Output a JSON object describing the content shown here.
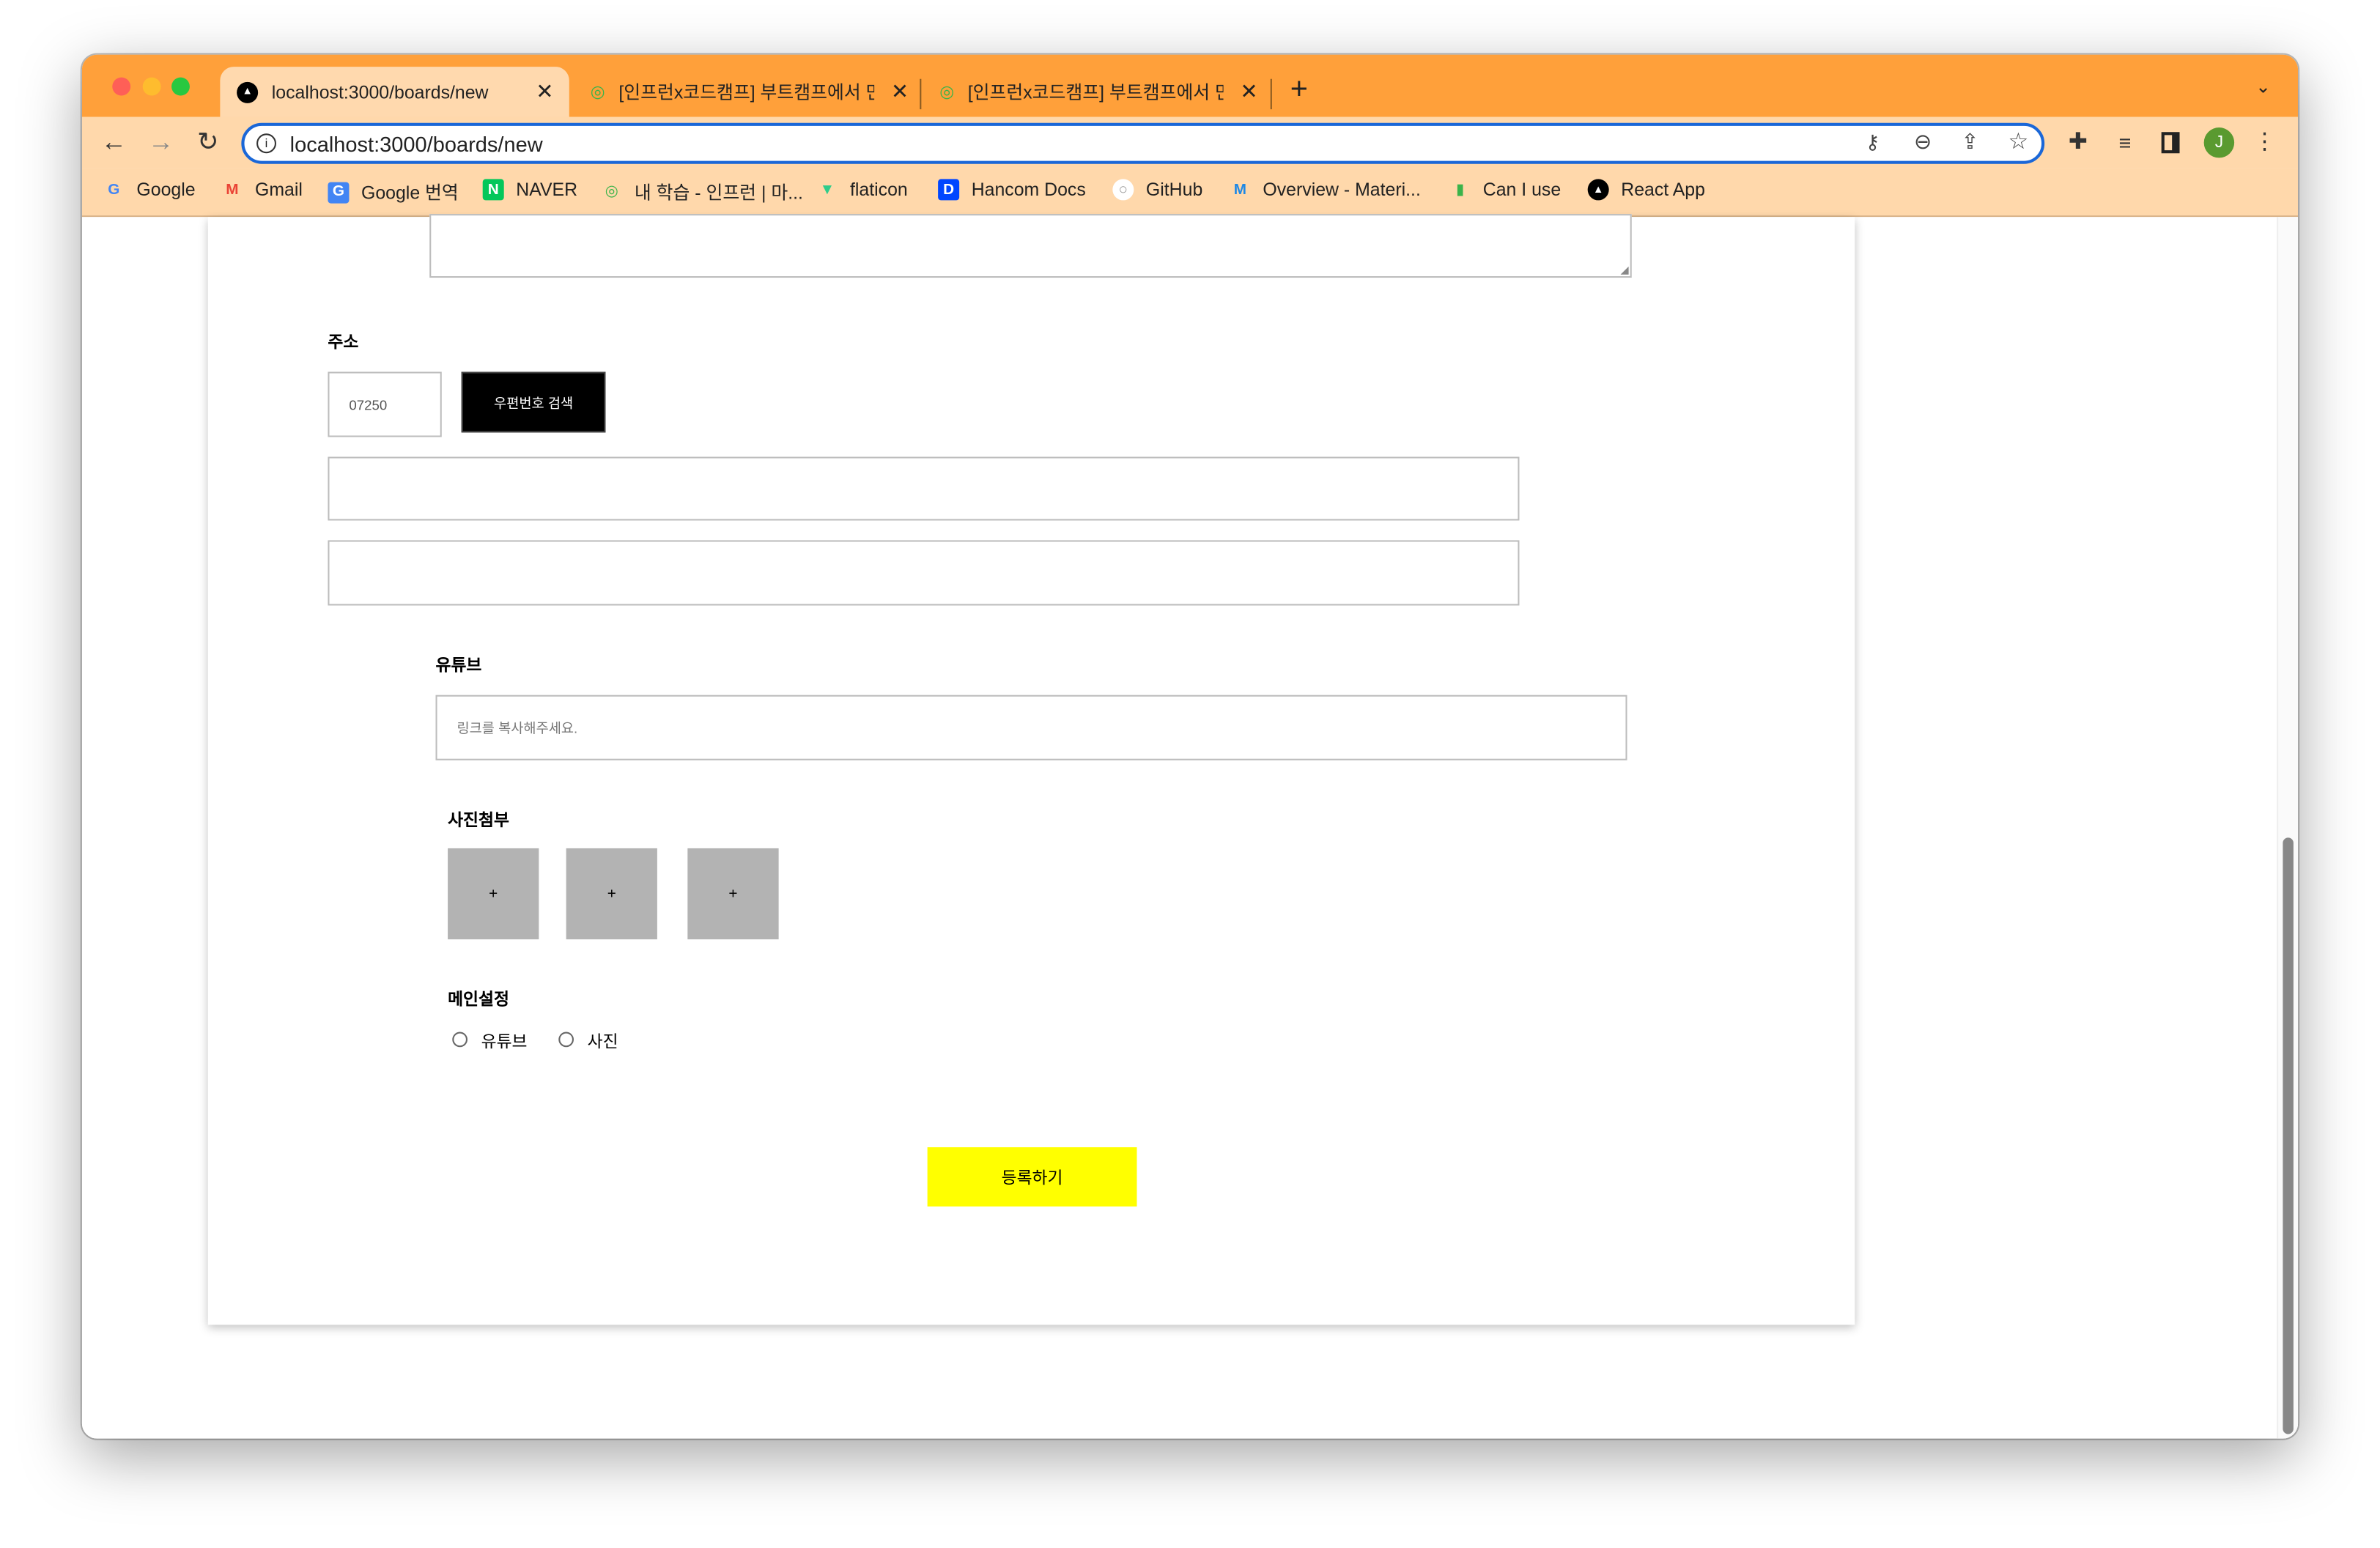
{
  "browser": {
    "tabs": [
      {
        "title": "localhost:3000/boards/new",
        "active": true,
        "icon": "react-triangle-icon"
      },
      {
        "title": "[인프런x코드캠프] 부트캠프에서 만든",
        "active": false,
        "icon": "inflearn-icon"
      },
      {
        "title": "[인프런x코드캠프] 부트캠프에서 만든",
        "active": false,
        "icon": "inflearn-icon"
      }
    ],
    "url": "localhost:3000/boards/new",
    "avatar_letter": "J",
    "bookmarks": [
      {
        "label": "Google",
        "icon": "G"
      },
      {
        "label": "Gmail",
        "icon": "M"
      },
      {
        "label": "Google 번역",
        "icon": "G"
      },
      {
        "label": "NAVER",
        "icon": "N"
      },
      {
        "label": "내 학습 - 인프런 | 마...",
        "icon": "i"
      },
      {
        "label": "flaticon",
        "icon": "F"
      },
      {
        "label": "Hancom Docs",
        "icon": "D"
      },
      {
        "label": "GitHub",
        "icon": "○"
      },
      {
        "label": "Overview - Materi...",
        "icon": "M"
      },
      {
        "label": "Can I use",
        "icon": "▮"
      },
      {
        "label": "React App",
        "icon": "▲"
      }
    ],
    "colors": {
      "tabbar": "#FFA03A",
      "toolbar": "#FFD8AB",
      "omnibox_border": "#1A67D8",
      "avatar": "#5A9A30"
    }
  },
  "form": {
    "address_label": "주소",
    "zipcode_value": "07250",
    "zipcode_button": "우편번호 검색",
    "address1_value": "",
    "address2_value": "",
    "youtube_label": "유튜브",
    "youtube_placeholder": "링크를 복사해주세요.",
    "photo_label": "사진첨부",
    "photo_slots": [
      "+",
      "+",
      "+"
    ],
    "main_label": "메인설정",
    "radio_options": [
      "유튜브",
      "사진"
    ],
    "submit_label": "등록하기",
    "colors": {
      "submit": "#FFFF00",
      "zip_button": "#000000",
      "photo_slot": "#B3B3B3"
    }
  }
}
